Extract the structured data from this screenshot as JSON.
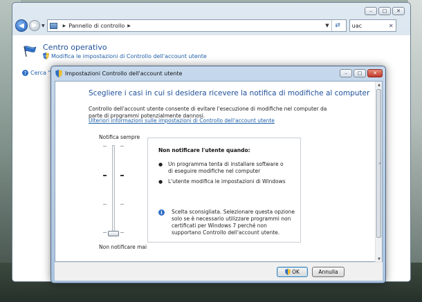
{
  "control_panel": {
    "address": {
      "location": "Pannello di controllo",
      "search_value": "uac"
    },
    "title": "Centro operativo",
    "subitem": "Modifica le impostazioni di Controllo dell'account utente",
    "help_link": "Cerca \"u"
  },
  "uac_dialog": {
    "title": "Impostazioni Controllo dell'account utente",
    "heading": "Scegliere i casi in cui si desidera ricevere la notifica di modifiche al computer",
    "description": "Controllo dell'account utente consente di evitare l'esecuzione di modifiche nel computer da parte di programmi potenzialmente dannosi.",
    "link": "Ulteriori informazioni sulle impostazioni di Controllo dell'account utente",
    "slider": {
      "label_top": "Notifica sempre",
      "label_bottom": "Non notificare mai",
      "levels": 4,
      "selected_level": 1
    },
    "info": {
      "title": "Non notificare l'utente quando:",
      "bullets": [
        "Un programma tenta di installare software o di eseguire modifiche nel computer",
        "L'utente modifica le impostazioni di Windows"
      ],
      "note": "Scelta sconsigliata. Selezionare questa opzione solo se è necessario utilizzare programmi non certificati per Windows 7 perché non supportano Controllo dell'account utente."
    },
    "buttons": {
      "ok": "OK",
      "cancel": "Annulla"
    }
  },
  "colors": {
    "heading_blue": "#1e4f9a",
    "link_blue": "#1f5fa8",
    "close_red": "#c0392b"
  },
  "icons": {
    "back": "back-arrow-icon",
    "forward": "forward-arrow-icon",
    "refresh": "refresh-icon",
    "flag": "action-center-flag-icon",
    "shield": "uac-shield-icon",
    "info": "info-icon",
    "help": "help-icon"
  }
}
